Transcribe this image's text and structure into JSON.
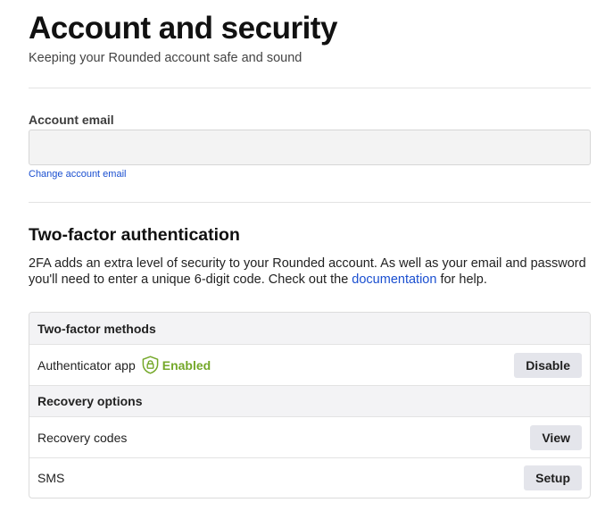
{
  "page": {
    "title": "Account and security",
    "subtitle": "Keeping your Rounded account safe and sound"
  },
  "account_email": {
    "label": "Account email",
    "value": "",
    "placeholder": "",
    "change_link": "Change account email"
  },
  "two_factor": {
    "title": "Two-factor authentication",
    "description_before": "2FA adds an extra level of security to your Rounded account. As well as your email and password you'll need to enter a unique 6-digit code. Check out the ",
    "description_link": "documentation",
    "description_after": " for help.",
    "methods_header": "Two-factor methods",
    "methods": [
      {
        "label": "Authenticator app",
        "status": "Enabled",
        "status_icon": "shield-lock-icon",
        "status_color": "#74a829",
        "button": "Disable"
      }
    ],
    "recovery_header": "Recovery options",
    "recovery": [
      {
        "label": "Recovery codes",
        "button": "View"
      },
      {
        "label": "SMS",
        "button": "Setup"
      }
    ]
  }
}
